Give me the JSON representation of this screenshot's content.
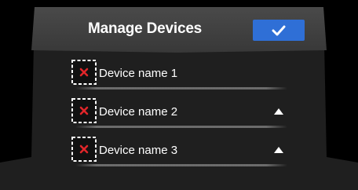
{
  "header": {
    "title": "Manage Devices",
    "confirm_icon": "checkmark-icon"
  },
  "devices": [
    {
      "name": "Device name 1",
      "remove_icon": "remove-x-icon",
      "has_move_up": false
    },
    {
      "name": "Device name 2",
      "remove_icon": "remove-x-icon",
      "has_move_up": true,
      "move_icon": "move-up-arrow-icon"
    },
    {
      "name": "Device name 3",
      "remove_icon": "remove-x-icon",
      "has_move_up": true,
      "move_icon": "move-up-arrow-icon"
    }
  ],
  "colors": {
    "accent": "#2f6fd6",
    "remove": "#e0262a",
    "text": "#ffffff",
    "panel": "#1f1f1f",
    "header": "#444444"
  }
}
